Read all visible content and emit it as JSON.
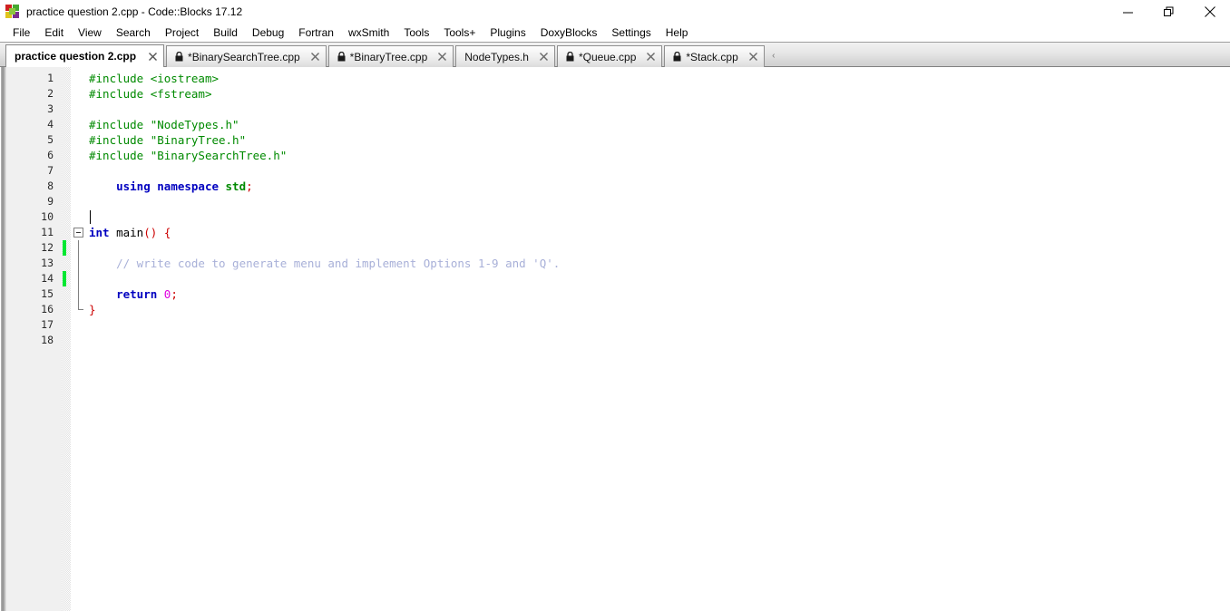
{
  "window": {
    "title": "practice question 2.cpp - Code::Blocks 17.12",
    "icon": "codeblocks-icon",
    "controls": [
      {
        "name": "minimize-button",
        "glyph": "minimize"
      },
      {
        "name": "restore-button",
        "glyph": "restore"
      },
      {
        "name": "close-button",
        "glyph": "close"
      }
    ]
  },
  "menubar": {
    "items": [
      "File",
      "Edit",
      "View",
      "Search",
      "Project",
      "Build",
      "Debug",
      "Fortran",
      "wxSmith",
      "Tools",
      "Tools+",
      "Plugins",
      "DoxyBlocks",
      "Settings",
      "Help"
    ]
  },
  "tabs": [
    {
      "label": "practice question 2.cpp",
      "active": true,
      "locked": false,
      "modified": false
    },
    {
      "label": "*BinarySearchTree.cpp",
      "active": false,
      "locked": true,
      "modified": true
    },
    {
      "label": "*BinaryTree.cpp",
      "active": false,
      "locked": true,
      "modified": true
    },
    {
      "label": "NodeTypes.h",
      "active": false,
      "locked": false,
      "modified": false
    },
    {
      "label": "*Queue.cpp",
      "active": false,
      "locked": true,
      "modified": true
    },
    {
      "label": "*Stack.cpp",
      "active": false,
      "locked": true,
      "modified": true
    }
  ],
  "editor": {
    "line_count": 18,
    "line_numbers": [
      1,
      2,
      3,
      4,
      5,
      6,
      7,
      8,
      9,
      10,
      11,
      12,
      13,
      14,
      15,
      16,
      17,
      18
    ],
    "caret_line": 10,
    "changed_lines": [
      12,
      14
    ],
    "fold_start_line": 11,
    "fold_end_line": 16,
    "lines": [
      {
        "n": 1,
        "tokens": [
          {
            "t": "#include ",
            "c": "pre"
          },
          {
            "t": "<iostream>",
            "c": "pre"
          }
        ]
      },
      {
        "n": 2,
        "tokens": [
          {
            "t": "#include ",
            "c": "pre"
          },
          {
            "t": "<fstream>",
            "c": "pre"
          }
        ]
      },
      {
        "n": 3,
        "tokens": []
      },
      {
        "n": 4,
        "tokens": [
          {
            "t": "#include ",
            "c": "pre"
          },
          {
            "t": "\"NodeTypes.h\"",
            "c": "pre"
          }
        ]
      },
      {
        "n": 5,
        "tokens": [
          {
            "t": "#include ",
            "c": "pre"
          },
          {
            "t": "\"BinaryTree.h\"",
            "c": "pre"
          }
        ]
      },
      {
        "n": 6,
        "tokens": [
          {
            "t": "#include ",
            "c": "pre"
          },
          {
            "t": "\"BinarySearchTree.h\"",
            "c": "pre"
          }
        ]
      },
      {
        "n": 7,
        "tokens": []
      },
      {
        "n": 8,
        "tokens": [
          {
            "t": "    ",
            "c": "id"
          },
          {
            "t": "using namespace ",
            "c": "kw"
          },
          {
            "t": "std",
            "c": "std"
          },
          {
            "t": ";",
            "c": "op"
          }
        ]
      },
      {
        "n": 9,
        "tokens": []
      },
      {
        "n": 10,
        "tokens": []
      },
      {
        "n": 11,
        "tokens": [
          {
            "t": "int",
            "c": "kw"
          },
          {
            "t": " main",
            "c": "id"
          },
          {
            "t": "()",
            "c": "op"
          },
          {
            "t": " ",
            "c": "id"
          },
          {
            "t": "{",
            "c": "op"
          }
        ]
      },
      {
        "n": 12,
        "tokens": []
      },
      {
        "n": 13,
        "tokens": [
          {
            "t": "    ",
            "c": "id"
          },
          {
            "t": "// write code to generate menu and implement Options 1-9 and 'Q'.",
            "c": "cmt"
          }
        ]
      },
      {
        "n": 14,
        "tokens": []
      },
      {
        "n": 15,
        "tokens": [
          {
            "t": "    ",
            "c": "id"
          },
          {
            "t": "return ",
            "c": "kw"
          },
          {
            "t": "0",
            "c": "num"
          },
          {
            "t": ";",
            "c": "op"
          }
        ]
      },
      {
        "n": 16,
        "tokens": [
          {
            "t": "}",
            "c": "op"
          }
        ]
      },
      {
        "n": 17,
        "tokens": []
      },
      {
        "n": 18,
        "tokens": []
      }
    ]
  },
  "colors": {
    "preprocessor": "#008a00",
    "keyword": "#0000c0",
    "std_identifier": "#008a00",
    "operator": "#cc0000",
    "number": "#e000e0",
    "comment": "#a8b0d8",
    "change_marker": "#00e832",
    "gutter_bg": "#f0f0f0",
    "editor_bg": "#ffffff"
  }
}
